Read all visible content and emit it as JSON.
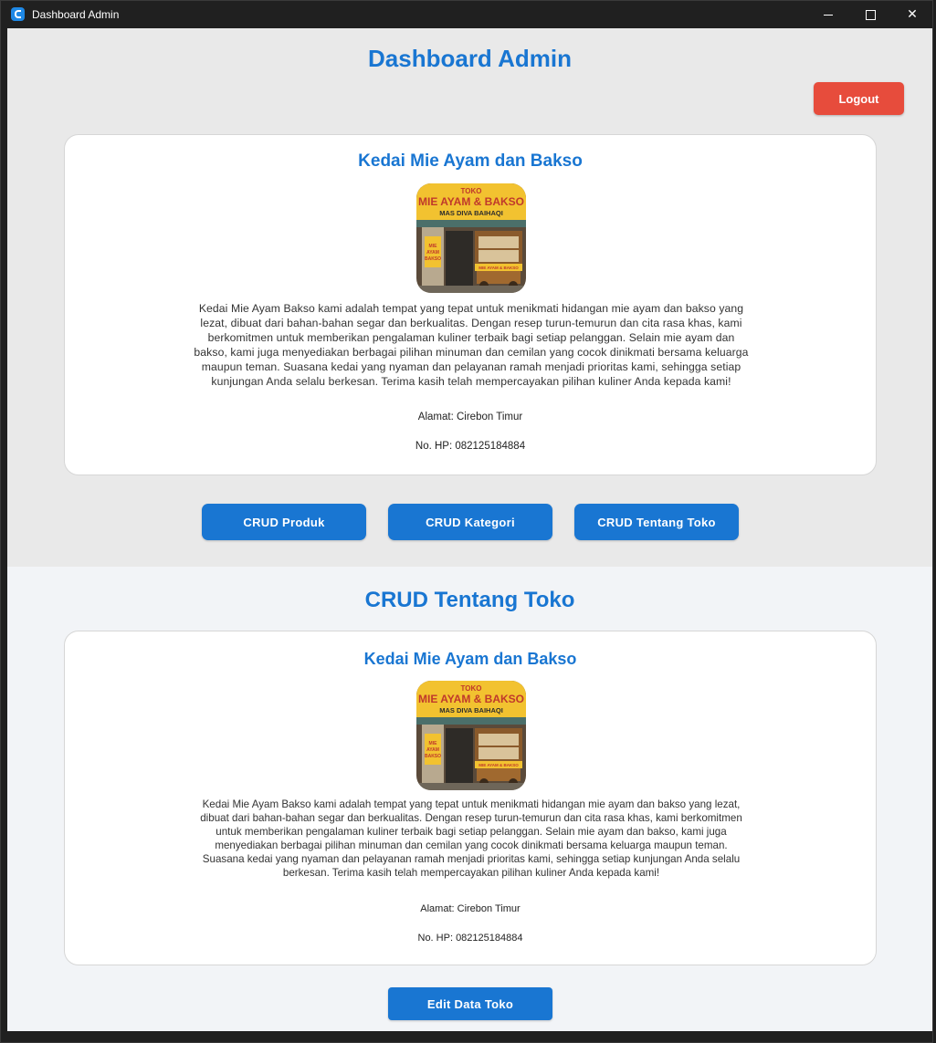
{
  "window": {
    "title": "Dashboard Admin"
  },
  "header": {
    "title": "Dashboard Admin",
    "logout_label": "Logout"
  },
  "store": {
    "name": "Kedai Mie Ayam dan Bakso",
    "description": "Kedai Mie Ayam Bakso kami adalah tempat yang tepat untuk menikmati hidangan mie ayam dan bakso yang lezat, dibuat dari bahan-bahan segar dan berkualitas. Dengan resep turun-temurun dan cita rasa khas, kami berkomitmen untuk memberikan pengalaman kuliner terbaik bagi setiap pelanggan. Selain mie ayam dan bakso, kami juga menyediakan berbagai pilihan minuman dan cemilan yang cocok dinikmati bersama keluarga maupun teman. Suasana kedai yang nyaman dan pelayanan ramah menjadi prioritas kami, sehingga setiap kunjungan Anda selalu berkesan. Terima kasih telah mempercayakan pilihan kuliner Anda kepada kami!",
    "address": "Alamat: Cirebon Timur",
    "phone": "No. HP: 082125184884",
    "sign": {
      "line1": "TOKO",
      "line2": "MIE AYAM & BAKSO",
      "line3": "MAS DIVA BAIHAQI",
      "side": "MIE AYAM & BAKSO",
      "cart": "MIE AYAM & BAKSO"
    }
  },
  "nav": {
    "crud_produk": "CRUD Produk",
    "crud_kategori": "CRUD Kategori",
    "crud_tentang": "CRUD Tentang Toko"
  },
  "crud_section": {
    "title": "CRUD Tentang Toko",
    "edit_label": "Edit Data Toko"
  },
  "colors": {
    "accent": "#1976d2",
    "danger": "#e74c3c",
    "sign_yellow": "#f2c230"
  }
}
